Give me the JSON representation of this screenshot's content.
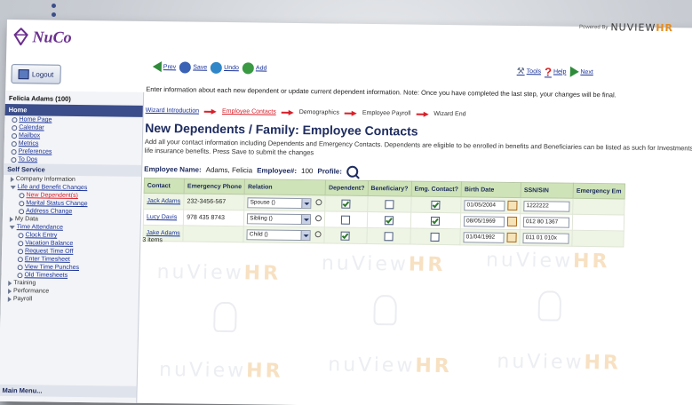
{
  "powered_by": {
    "label": "Powered By",
    "brand": "NUVIEW",
    "brand_accent": "HR"
  },
  "logo": {
    "text": "NuCo"
  },
  "logout": {
    "label": "Logout"
  },
  "sidebar": {
    "user": "Felicia Adams (100)",
    "home_header": "Home",
    "home_items": [
      "Home Page",
      "Calendar",
      "Mailbox",
      "Metrics",
      "Preferences",
      "To Dos"
    ],
    "self_service_header": "Self Service",
    "company_information": "Company Information",
    "life_and_benefit": "Life and Benefit Changes",
    "life_items": [
      "New Dependent(s)",
      "Marital Status Change",
      "Address Change"
    ],
    "my_data": "My Data",
    "time_attendance": "Time Attendance",
    "time_items": [
      "Clock Entry",
      "Vacation Balance",
      "Request Time Off",
      "Enter Timesheet",
      "View Time Punches",
      "Old Timesheets"
    ],
    "training": "Training",
    "performance": "Performance",
    "payroll": "Payroll",
    "main_menu": "Main Menu..."
  },
  "toolbar": {
    "prev": "Prev",
    "save": "Save",
    "undo": "Undo",
    "add": "Add",
    "tools": "Tools",
    "help": "Help",
    "next": "Next"
  },
  "intro_text": "Enter information about each new dependent or update current dependent information. Note: Once you have completed the last step, your changes will be final.",
  "wizard": {
    "steps": [
      "Wizard Introduction",
      "Employee Contacts",
      "Demographics",
      "Employee Payroll",
      "Wizard End"
    ]
  },
  "page_title": "New Dependents / Family: Employee Contacts",
  "description": "Add all your contact information including Dependents and Emergency Contacts. Dependents are eligible to be enrolled in benefits and Beneficiaries can be listed as such for Investments and life insurance benefits. Press Save to submit the changes",
  "employee": {
    "name_label": "Employee Name:",
    "name_value": "Adams, Felicia",
    "number_label": "Employee#:",
    "number_value": "100",
    "profile_label": "Profile:"
  },
  "table": {
    "headers": [
      "Contact",
      "Emergency Phone",
      "Relation",
      "Dependent?",
      "Beneficiary?",
      "Emg. Contact?",
      "Birth Date",
      "SSN/SIN",
      "Emergency Em"
    ],
    "rows": [
      {
        "contact": "Jack Adams",
        "phone": "232-3456-567",
        "relation": "Spouse ()",
        "dependent": true,
        "beneficiary": false,
        "emg_contact": true,
        "birth_date": "01/05/2004",
        "ssn": "1222222"
      },
      {
        "contact": "Lucy Davis",
        "phone": "978 435 8743",
        "relation": "Sibling ()",
        "dependent": false,
        "beneficiary": true,
        "emg_contact": true,
        "birth_date": "08/05/1969",
        "ssn": "012 80 1367"
      },
      {
        "contact": "Jake Adams",
        "phone": "",
        "relation": "Child ()",
        "dependent": true,
        "beneficiary": false,
        "emg_contact": false,
        "birth_date": "01/04/1992",
        "ssn": "011 01 010x"
      }
    ],
    "items_count": "3 items"
  },
  "watermark": {
    "text": "nuView",
    "accent": "HR"
  },
  "colors": {
    "header_navy": "#3b4d8a",
    "table_header": "#cfe3b8",
    "alt_row": "#eef5e5",
    "active_link": "#d8202a",
    "brand_accent": "#e58a1b"
  }
}
